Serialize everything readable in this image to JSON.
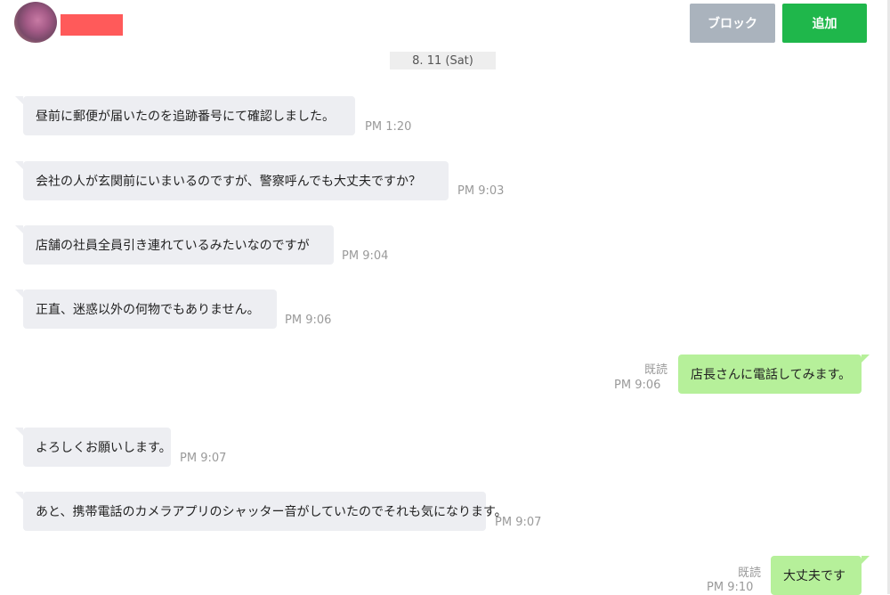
{
  "header": {
    "avatar_icon": "user-avatar-icon",
    "block_label": "ブロック",
    "add_label": "追加",
    "colors": {
      "block": "#aab3bd",
      "add": "#1fb74b",
      "redaction": "#ff5a5a"
    }
  },
  "date_label": "8. 11 (Sat)",
  "colors": {
    "incoming_bubble": "#edeef2",
    "outgoing_bubble": "#b6f09a",
    "timestamp": "#9a9a9a"
  },
  "messages": [
    {
      "direction": "in",
      "text": "昼前に郵便が届いたのを追跡番号にて確認しました。",
      "time": "PM 1:20"
    },
    {
      "direction": "in",
      "text": "会社の人が玄関前にいまいるのですが、警察呼んでも大丈夫ですか？",
      "time": "PM 9:03"
    },
    {
      "direction": "in",
      "text": "店舗の社員全員引き連れているみたいなのですが",
      "time": "PM 9:04"
    },
    {
      "direction": "in",
      "text": "正直、迷惑以外の何物でもありません。",
      "time": "PM 9:06"
    },
    {
      "direction": "out",
      "text": "店長さんに電話してみます。",
      "read": "既読",
      "time": "PM 9:06"
    },
    {
      "direction": "in",
      "text": "よろしくお願いします。",
      "time": "PM 9:07"
    },
    {
      "direction": "in",
      "text": "あと、携帯電話のカメラアプリのシャッター音がしていたのでそれも気になります。",
      "time": "PM 9:07"
    },
    {
      "direction": "out",
      "text": "大丈夫です",
      "read": "既読",
      "time": "PM 9:10"
    }
  ]
}
